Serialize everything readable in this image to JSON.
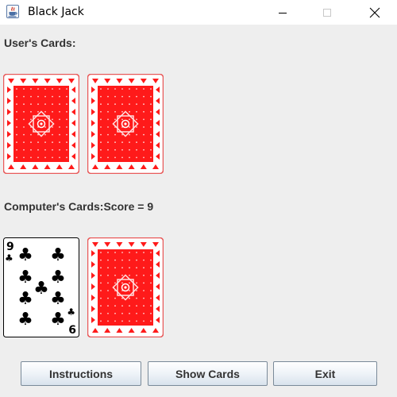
{
  "window": {
    "title": "Black Jack",
    "icon": "java-cup-icon",
    "controls": [
      "minimize-icon",
      "maximize-icon",
      "close-icon"
    ]
  },
  "user": {
    "label": "User's Cards:",
    "cards": [
      {
        "face": "back"
      },
      {
        "face": "back"
      }
    ]
  },
  "computer": {
    "label": "Computer's Cards:Score = 9",
    "cards": [
      {
        "face": "front",
        "rank": "9",
        "suit": "clubs",
        "suit_symbol": "♣",
        "rank_bottom": "6"
      },
      {
        "face": "back"
      }
    ]
  },
  "buttons": {
    "instructions": "Instructions",
    "show_cards": "Show Cards",
    "exit": "Exit"
  },
  "colors": {
    "card_back_red": "#ff1a1a",
    "card_back_border": "#e85a5a",
    "button_border": "#7a8a99",
    "background": "#eeeeee"
  }
}
